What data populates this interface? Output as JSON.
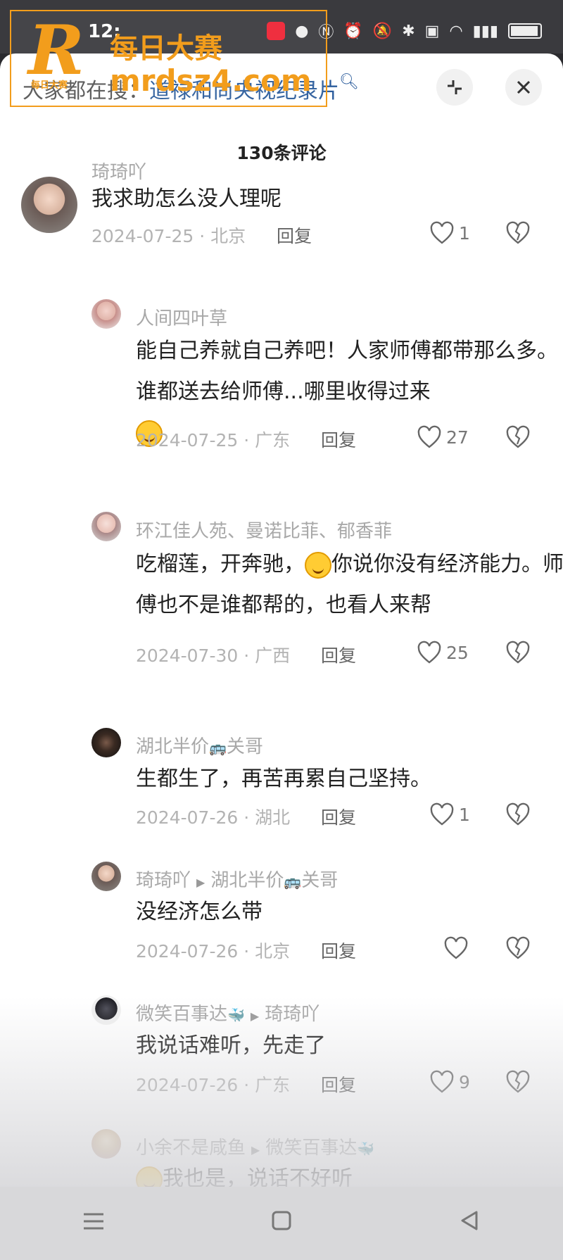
{
  "status_bar": {
    "time": "12:"
  },
  "watermark": {
    "logo_letter": "R",
    "logo_small": "每日大赛",
    "title": "每日大赛",
    "url": "mrdsz4.com"
  },
  "search_hint": {
    "prefix": "大家都在搜：",
    "keyword": "道禄和尚央视纪录片"
  },
  "header": {
    "comment_count": "130条评论"
  },
  "comments": [
    {
      "user": "琦琦吖",
      "text": "我求助怎么没人理呢",
      "date": "2024-07-25 · 北京",
      "reply": "回复",
      "likes": "1"
    },
    {
      "user": "人间四叶草",
      "text": "能自己养就自己养吧！人家师傅都带那么多。谁都送去给师傅...哪里收得过来",
      "date": "2024-07-25 · 广东",
      "reply": "回复",
      "likes": "27"
    },
    {
      "user": "环江佳人苑、曼诺比菲、郁香菲",
      "text_before": "吃榴莲，开奔驰，",
      "text_after": "你说你没有经济能力。师傅也不是谁都帮的，也看人来帮",
      "date": "2024-07-30 · 广西",
      "reply": "回复",
      "likes": "25"
    },
    {
      "user": "湖北半价",
      "user_suffix": "关哥",
      "text": "生都生了，再苦再累自己坚持。",
      "date": "2024-07-26 · 湖北",
      "reply": "回复",
      "likes": "1"
    },
    {
      "user": "琦琦吖",
      "reply_to": "湖北半价",
      "reply_to_suffix": "关哥",
      "text": "没经济怎么带",
      "date": "2024-07-26 · 北京",
      "reply": "回复",
      "likes": ""
    },
    {
      "user": "微笑百事达",
      "reply_to": "琦琦吖",
      "text": "我说话难听，先走了",
      "date": "2024-07-26 · 广东",
      "reply": "回复",
      "likes": "9"
    },
    {
      "user": "小余不是咸鱼",
      "reply_to": "微笑百事达",
      "text": "我也是，说话不好听"
    }
  ],
  "colors": {
    "keyword": "#2b5c9c",
    "watermark": "#f29d1c",
    "meta": "#b3b3b3"
  },
  "icons": {
    "collapse": "collapse-icon",
    "close": "close-icon",
    "like": "heart-icon",
    "dislike": "broken-heart-icon"
  }
}
